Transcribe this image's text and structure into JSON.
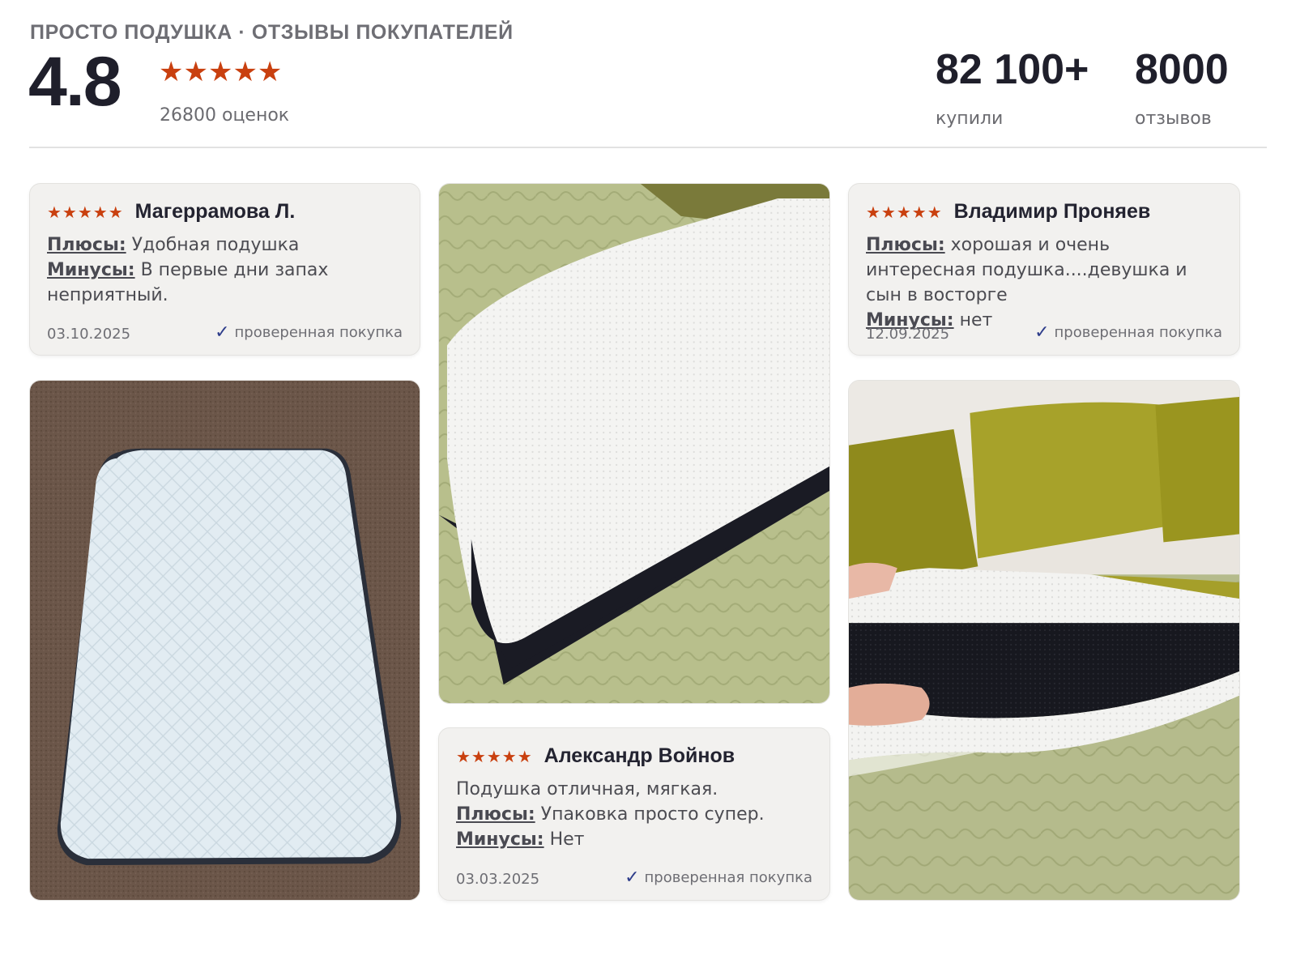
{
  "header": {
    "brand_line": "ПРОСТО ПОДУШКА · ОТЗЫВЫ ПОКУПАТЕЛЕЙ",
    "rating": "4.8",
    "stars": "★★★★★",
    "ratings_count": "26800 оценок",
    "stats": [
      {
        "value": "82 100+",
        "label": "купили"
      },
      {
        "value": "8000",
        "label": "отзывов"
      }
    ]
  },
  "colors": {
    "star": "#c9400f",
    "check": "#2d3c8a"
  },
  "reviews": [
    {
      "stars": "★★★★★",
      "author": "Магеррамова Л.",
      "intro": "",
      "pros_label": "Плюсы:",
      "pros": "Удобная подушка",
      "cons_label": "Минусы:",
      "cons": "В первые дни запах неприятный.",
      "date": "03.10.2025",
      "verified": "проверенная покупка"
    },
    {
      "stars": "★★★★★",
      "author": "Владимир Проняев",
      "intro": "",
      "pros_label": "Плюсы:",
      "pros": "хорошая и очень интересная подушка....девушка и сын в восторге",
      "cons_label": "Минусы:",
      "cons": "нет",
      "date": "12.09.2025",
      "verified": "проверенная покупка"
    },
    {
      "stars": "★★★★★",
      "author": "Александр Войнов",
      "intro": "Подушка отличная, мягкая.",
      "pros_label": "Плюсы:",
      "pros": "Упаковка просто супер.",
      "cons_label": "Минусы:",
      "cons": "Нет",
      "date": "03.03.2025",
      "verified": "проверенная покупка"
    }
  ],
  "photos": [
    {
      "icon": "pillow-on-carpet-photo"
    },
    {
      "icon": "pillow-on-bed-photo"
    },
    {
      "icon": "pillow-held-in-hand-photo"
    }
  ]
}
